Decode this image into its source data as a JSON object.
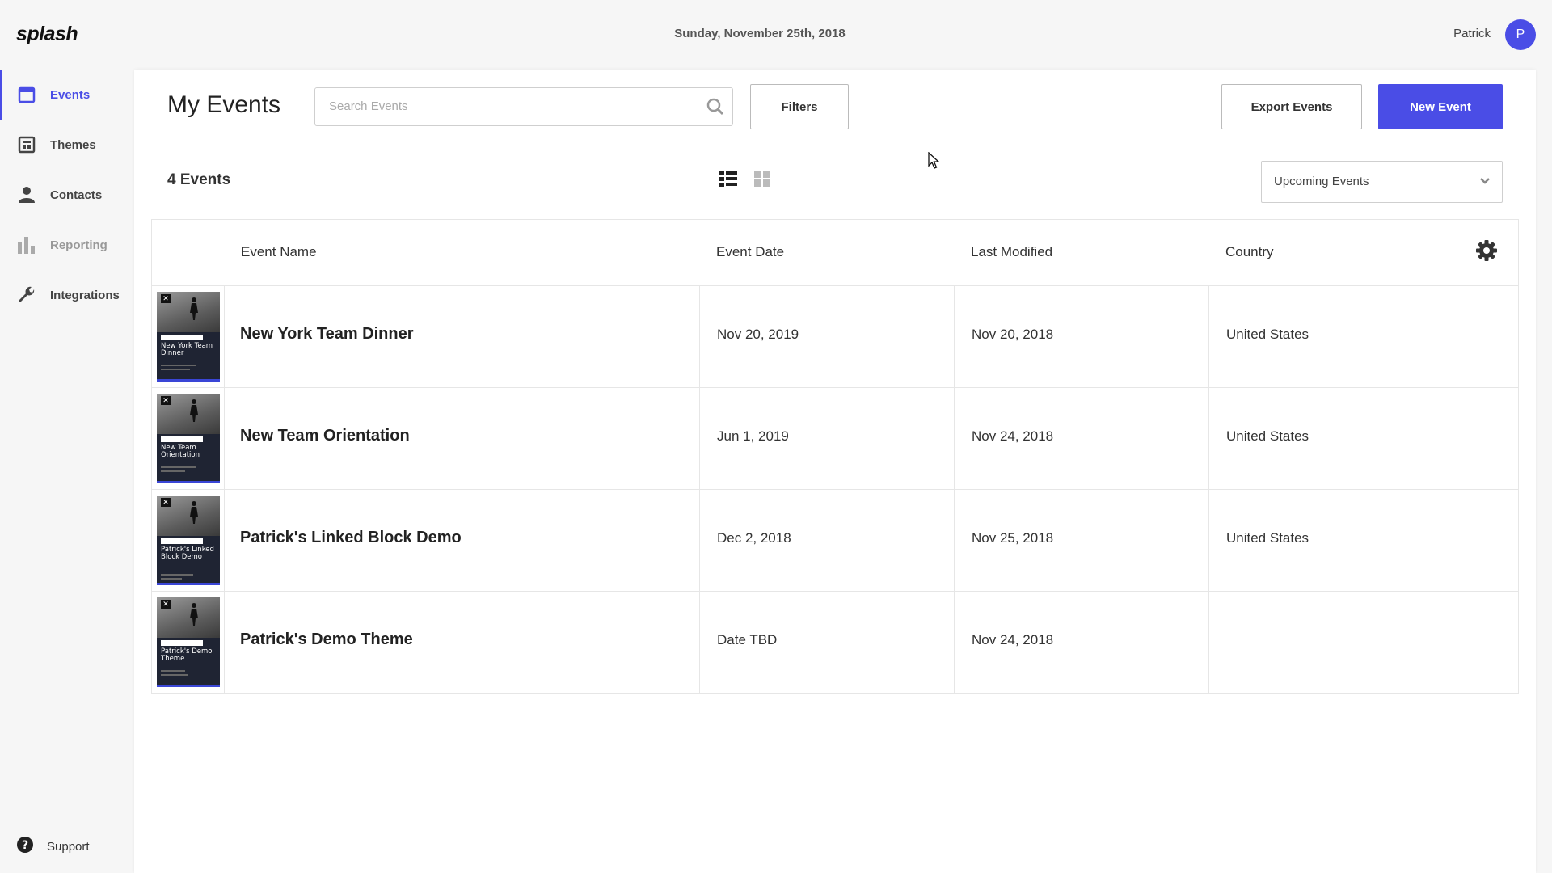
{
  "app": {
    "logo": "splash"
  },
  "header": {
    "date": "Sunday, November 25th, 2018",
    "user_name": "Patrick",
    "avatar_initial": "P"
  },
  "sidebar": {
    "items": [
      {
        "label": "Events",
        "icon": "calendar-icon",
        "active": true
      },
      {
        "label": "Themes",
        "icon": "layout-icon"
      },
      {
        "label": "Contacts",
        "icon": "person-icon"
      },
      {
        "label": "Reporting",
        "icon": "bar-chart-icon",
        "disabled": true
      },
      {
        "label": "Integrations",
        "icon": "wrench-icon"
      }
    ],
    "support": {
      "label": "Support",
      "icon": "question-icon"
    }
  },
  "main": {
    "title": "My Events",
    "search": {
      "placeholder": "Search Events",
      "value": ""
    },
    "filters_label": "Filters",
    "export_label": "Export Events",
    "new_event_label": "New Event",
    "count_label": "4 Events",
    "view_modes": [
      "list",
      "grid"
    ],
    "active_view": "list",
    "filter_select": {
      "value": "Upcoming Events"
    },
    "accent_color": "#4a4de6"
  },
  "table": {
    "columns": [
      "Event Name",
      "Event Date",
      "Last Modified",
      "Country"
    ],
    "rows": [
      {
        "name": "New York Team Dinner",
        "thumb_title": "New York Team Dinner",
        "event_date": "Nov 20, 2019",
        "last_modified": "Nov 20, 2018",
        "country": "United States"
      },
      {
        "name": "New Team Orientation",
        "thumb_title": "New Team Orientation",
        "event_date": "Jun 1, 2019",
        "last_modified": "Nov 24, 2018",
        "country": "United States"
      },
      {
        "name": "Patrick's Linked Block Demo",
        "thumb_title": "Patrick's Linked Block Demo",
        "event_date": "Dec 2, 2018",
        "last_modified": "Nov 25, 2018",
        "country": "United States"
      },
      {
        "name": "Patrick's Demo Theme",
        "thumb_title": "Patrick's Demo Theme",
        "event_date": "Date TBD",
        "last_modified": "Nov 24, 2018",
        "country": ""
      }
    ]
  }
}
